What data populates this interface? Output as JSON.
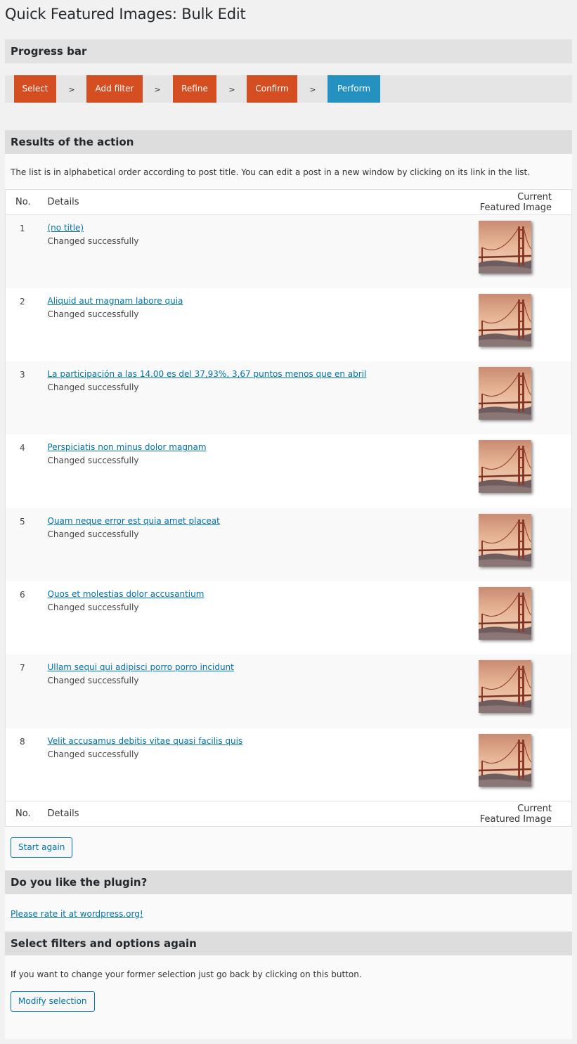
{
  "page": {
    "title": "Quick Featured Images: Bulk Edit"
  },
  "progress": {
    "heading": "Progress bar",
    "separator": ">",
    "steps": [
      {
        "label": "Select",
        "state": "done"
      },
      {
        "label": "Add filter",
        "state": "done"
      },
      {
        "label": "Refine",
        "state": "done"
      },
      {
        "label": "Confirm",
        "state": "done"
      },
      {
        "label": "Perform",
        "state": "current"
      }
    ],
    "colors": {
      "done": "#d54e21",
      "current": "#2591c0"
    }
  },
  "results": {
    "heading": "Results of the action",
    "intro": "The list is in alphabetical order according to post title. You can edit a post in a new window by clicking on its link in the list.",
    "columns": {
      "no": "No.",
      "details": "Details",
      "image": "Current Featured Image"
    },
    "rows": [
      {
        "no": "1",
        "title": "(no title)",
        "status": "Changed successfully"
      },
      {
        "no": "2",
        "title": "Aliquid aut magnam labore quia",
        "status": "Changed successfully"
      },
      {
        "no": "3",
        "title": "La participación a las 14.00 es del 37,93%, 3,67 puntos menos que en abril",
        "status": "Changed successfully"
      },
      {
        "no": "4",
        "title": "Perspiciatis non minus dolor magnam",
        "status": "Changed successfully"
      },
      {
        "no": "5",
        "title": "Quam neque error est quia amet placeat",
        "status": "Changed successfully"
      },
      {
        "no": "6",
        "title": "Quos et molestias dolor accusantium",
        "status": "Changed successfully"
      },
      {
        "no": "7",
        "title": "Ullam sequi qui adipisci porro porro incidunt",
        "status": "Changed successfully"
      },
      {
        "no": "8",
        "title": "Velit accusamus debitis vitae quasi facilis quis",
        "status": "Changed successfully"
      }
    ],
    "start_again_label": "Start again"
  },
  "like": {
    "heading": "Do you like the plugin?",
    "link_label": "Please rate it at wordpress.org!"
  },
  "again": {
    "heading": "Select filters and options again",
    "text": "If you want to change your former selection just go back by clicking on this button.",
    "button_label": "Modify selection"
  },
  "colors": {
    "link": "#0073aa",
    "accent": "#d54e21",
    "current": "#2591c0"
  }
}
